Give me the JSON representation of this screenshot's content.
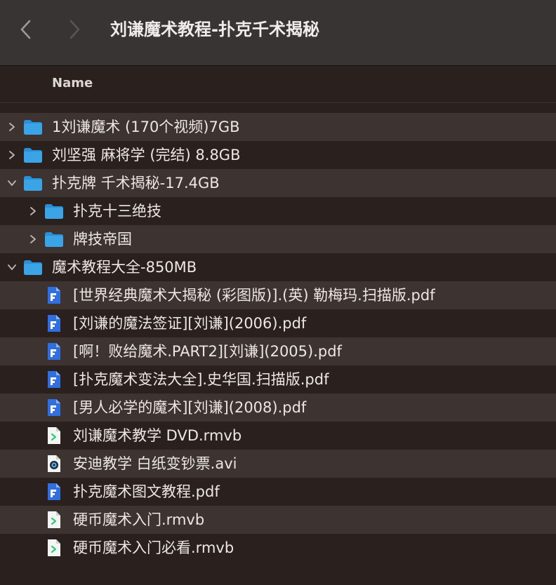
{
  "window": {
    "title": "刘谦魔术教程-扑克千术揭秘",
    "back_icon": "chevron-left-icon",
    "forward_icon": "chevron-right-icon"
  },
  "header": {
    "name_column": "Name"
  },
  "rows": [
    {
      "label": "1刘谦魔术 (170个视频)7GB",
      "icon": "folder-icon",
      "depth": 0,
      "disclosure": "collapsed"
    },
    {
      "label": "刘坚强 麻将学 (完结) 8.8GB",
      "icon": "folder-icon",
      "depth": 0,
      "disclosure": "collapsed"
    },
    {
      "label": "扑克牌 千术揭秘-17.4GB",
      "icon": "folder-icon",
      "depth": 0,
      "disclosure": "expanded"
    },
    {
      "label": "扑克十三绝技",
      "icon": "folder-icon",
      "depth": 1,
      "disclosure": "collapsed"
    },
    {
      "label": "牌技帝国",
      "icon": "folder-icon",
      "depth": 1,
      "disclosure": "collapsed"
    },
    {
      "label": "魔术教程大全-850MB",
      "icon": "folder-icon",
      "depth": 0,
      "disclosure": "expanded"
    },
    {
      "label": "[世界经典魔术大揭秘 (彩图版)].(英) 勒梅玛.扫描版.pdf",
      "icon": "pdf-file-icon",
      "depth": 1,
      "disclosure": "none"
    },
    {
      "label": "[刘谦的魔法签证][刘谦](2006).pdf",
      "icon": "pdf-file-icon",
      "depth": 1,
      "disclosure": "none"
    },
    {
      "label": "[啊！败给魔术.PART2][刘谦](2005).pdf",
      "icon": "pdf-file-icon",
      "depth": 1,
      "disclosure": "none"
    },
    {
      "label": "[扑克魔术变法大全].史华国.扫描版.pdf",
      "icon": "pdf-file-icon",
      "depth": 1,
      "disclosure": "none"
    },
    {
      "label": "[男人必学的魔术][刘谦](2008).pdf",
      "icon": "pdf-file-icon",
      "depth": 1,
      "disclosure": "none"
    },
    {
      "label": "刘谦魔术教学 DVD.rmvb",
      "icon": "video-file-icon",
      "depth": 1,
      "disclosure": "none"
    },
    {
      "label": "安迪教学 白纸变钞票.avi",
      "icon": "quicktime-file-icon",
      "depth": 1,
      "disclosure": "none"
    },
    {
      "label": "扑克魔术图文教程.pdf",
      "icon": "pdf-file-icon",
      "depth": 1,
      "disclosure": "none"
    },
    {
      "label": "硬币魔术入门.rmvb",
      "icon": "video-file-icon",
      "depth": 1,
      "disclosure": "none"
    },
    {
      "label": "硬币魔术入门必看.rmvb",
      "icon": "video-file-icon",
      "depth": 1,
      "disclosure": "none"
    }
  ],
  "colors": {
    "folder": "#3aa4e6",
    "pdf": "#2f6fe0",
    "video": "#2ecc71",
    "row_alt": "#3d3331",
    "background": "#2a211e"
  }
}
